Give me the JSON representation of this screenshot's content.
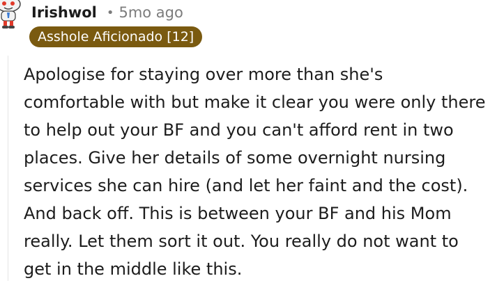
{
  "comment": {
    "author": "Irishwol",
    "separator": "•",
    "timestamp": "5mo ago",
    "flair": "Asshole Aficionado [12]",
    "body_lines": [
      "Apologise for staying over more than she's",
      "comfortable with but make it clear you were only there",
      "to help out your BF and you can't afford rent in two",
      "places. Give her details of some overnight nursing",
      "services she can hire (and let her faint and the cost).",
      "And back off. This is between your BF and his Mom",
      "really. Let them sort it out. You really do not want to",
      "get in the middle like this."
    ],
    "avatar_icon": "snoo-avatar-icon",
    "colors": {
      "flair_bg": "#7a5a10",
      "flair_text": "#ffffff",
      "meta": "#7c7c7c",
      "text": "#1c1c1c",
      "avatar_accent": "#e03a2a",
      "avatar_gold": "#e9b21a"
    }
  }
}
